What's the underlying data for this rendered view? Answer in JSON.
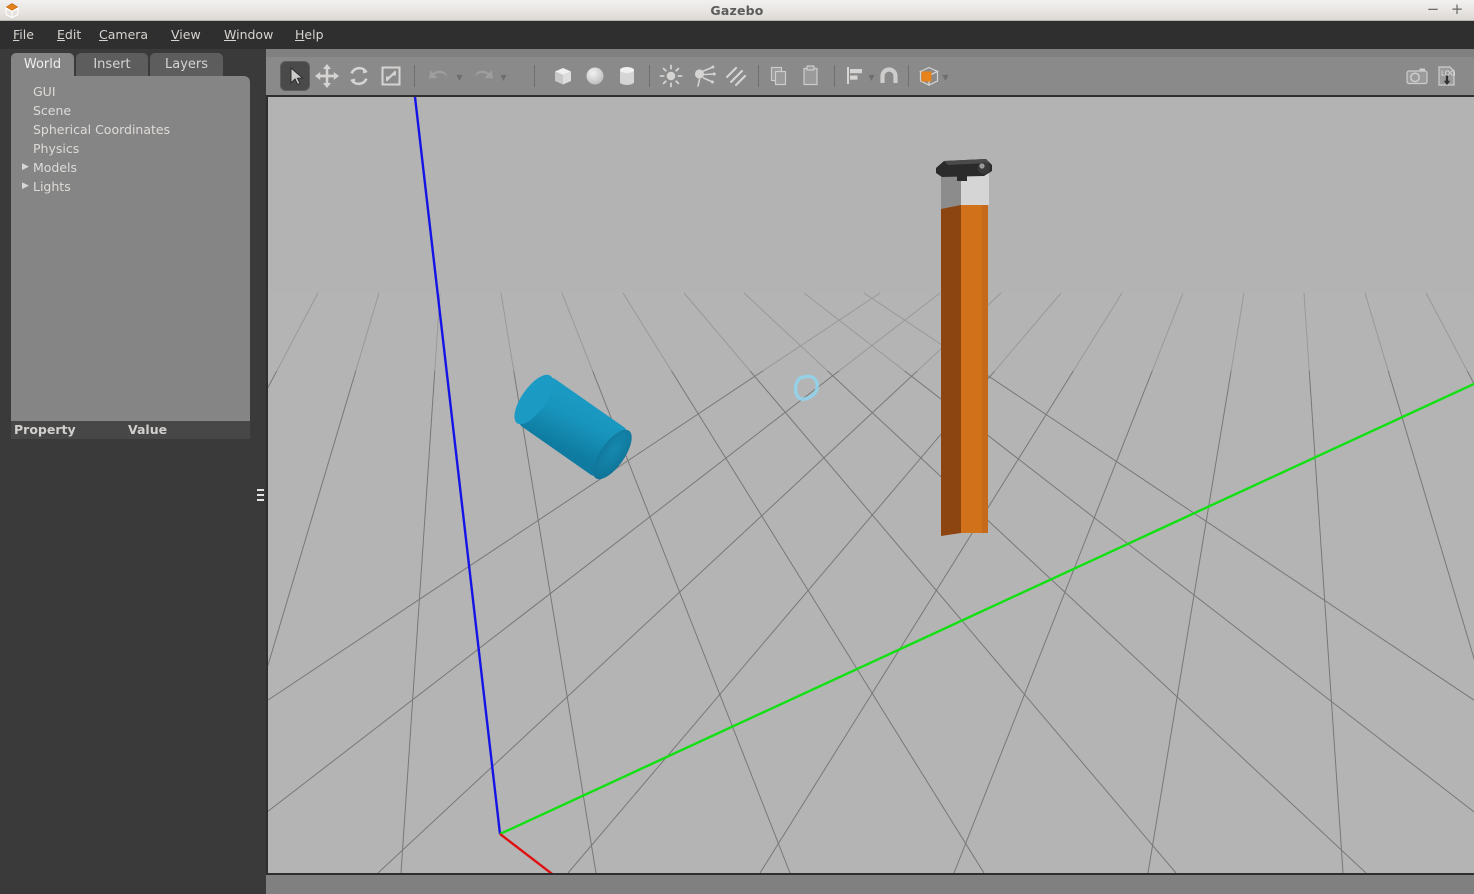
{
  "window": {
    "title": "Gazebo",
    "app_icon": "gazebo-logo-icon",
    "minimize_label": "−",
    "maximize_label": "+"
  },
  "menubar": {
    "items": [
      {
        "label": "File",
        "accel": "F",
        "rest": "ile"
      },
      {
        "label": "Edit",
        "accel": "E",
        "rest": "dit"
      },
      {
        "label": "Camera",
        "accel": "C",
        "rest": "amera"
      },
      {
        "label": "View",
        "accel": "V",
        "rest": "iew"
      },
      {
        "label": "Window",
        "accel": "W",
        "rest": "indow"
      },
      {
        "label": "Help",
        "accel": "H",
        "rest": "elp"
      }
    ]
  },
  "left_panel": {
    "tabs": [
      {
        "label": "World",
        "selected": true
      },
      {
        "label": "Insert",
        "selected": false
      },
      {
        "label": "Layers",
        "selected": false
      }
    ],
    "tree": [
      {
        "label": "GUI",
        "expandable": false
      },
      {
        "label": "Scene",
        "expandable": false
      },
      {
        "label": "Spherical Coordinates",
        "expandable": false
      },
      {
        "label": "Physics",
        "expandable": false
      },
      {
        "label": "Models",
        "expandable": true,
        "arrow": "▶"
      },
      {
        "label": "Lights",
        "expandable": true,
        "arrow": "▶"
      }
    ],
    "property_table": {
      "columns": [
        "Property",
        "Value"
      ],
      "rows": []
    }
  },
  "toolbar": {
    "groups": [
      {
        "name": "manipulation",
        "buttons": [
          {
            "name": "select-mode-button",
            "icon": "cursor-arrow-icon",
            "pressed": true
          },
          {
            "name": "translate-mode-button",
            "icon": "move-arrows-icon",
            "pressed": false
          },
          {
            "name": "rotate-mode-button",
            "icon": "rotate-arrows-icon",
            "pressed": false
          },
          {
            "name": "scale-mode-button",
            "icon": "scale-arrows-icon",
            "pressed": false
          }
        ]
      },
      {
        "name": "history",
        "buttons": [
          {
            "name": "undo-button",
            "icon": "undo-arrow-icon",
            "has_dropdown": true
          },
          {
            "name": "redo-button",
            "icon": "redo-arrow-icon",
            "has_dropdown": true
          }
        ]
      },
      {
        "name": "primitives",
        "buttons": [
          {
            "name": "insert-box-button",
            "icon": "box-icon"
          },
          {
            "name": "insert-sphere-button",
            "icon": "sphere-icon"
          },
          {
            "name": "insert-cylinder-button",
            "icon": "cylinder-icon"
          }
        ]
      },
      {
        "name": "lights",
        "buttons": [
          {
            "name": "insert-point-light-button",
            "icon": "point-light-icon"
          },
          {
            "name": "insert-spot-light-button",
            "icon": "spot-light-icon"
          },
          {
            "name": "insert-directional-light-button",
            "icon": "directional-light-icon"
          }
        ]
      },
      {
        "name": "clipboard",
        "buttons": [
          {
            "name": "copy-button",
            "icon": "copy-icon"
          },
          {
            "name": "paste-button",
            "icon": "paste-icon"
          }
        ]
      },
      {
        "name": "alignment",
        "buttons": [
          {
            "name": "align-button",
            "icon": "align-icon",
            "has_dropdown": true
          },
          {
            "name": "snap-button",
            "icon": "magnet-icon"
          }
        ]
      },
      {
        "name": "view-appearance",
        "buttons": [
          {
            "name": "view-mode-button",
            "icon": "orange-cube-icon",
            "has_dropdown": true,
            "color": "#e8821a"
          }
        ]
      },
      {
        "name": "capture",
        "buttons": [
          {
            "name": "screenshot-button",
            "icon": "camera-icon"
          },
          {
            "name": "log-record-button",
            "icon": "log-download-icon",
            "label": "LOG"
          }
        ]
      }
    ]
  },
  "viewport": {
    "name": "3d-scene-viewport",
    "background_color": "#b3b3b3",
    "ground_color": "#b4b4b4",
    "grid_line_color": "#6e6e6e",
    "axes": [
      {
        "name": "z-axis",
        "color": "#1414e6",
        "label": "Z"
      },
      {
        "name": "y-axis",
        "color": "#12e012",
        "label": "Y"
      },
      {
        "name": "x-axis",
        "color": "#e01010",
        "label": "X"
      }
    ],
    "objects": [
      {
        "name": "cyan-cylinder-model",
        "shape": "cylinder",
        "color": "#1b9bc4",
        "color_dark": "#117e9f",
        "orientation": "lying-on-side"
      },
      {
        "name": "orange-pole-model",
        "shape": "tall-box-column",
        "color_light": "#d1711a",
        "color_dark": "#8c4410"
      },
      {
        "name": "sensor-box-model",
        "shape": "box",
        "color_light": "#d5d5d5",
        "color_dark": "#858585"
      },
      {
        "name": "camera-sensor-model",
        "shape": "rounded-bar",
        "color": "#2b2b2b"
      }
    ]
  }
}
